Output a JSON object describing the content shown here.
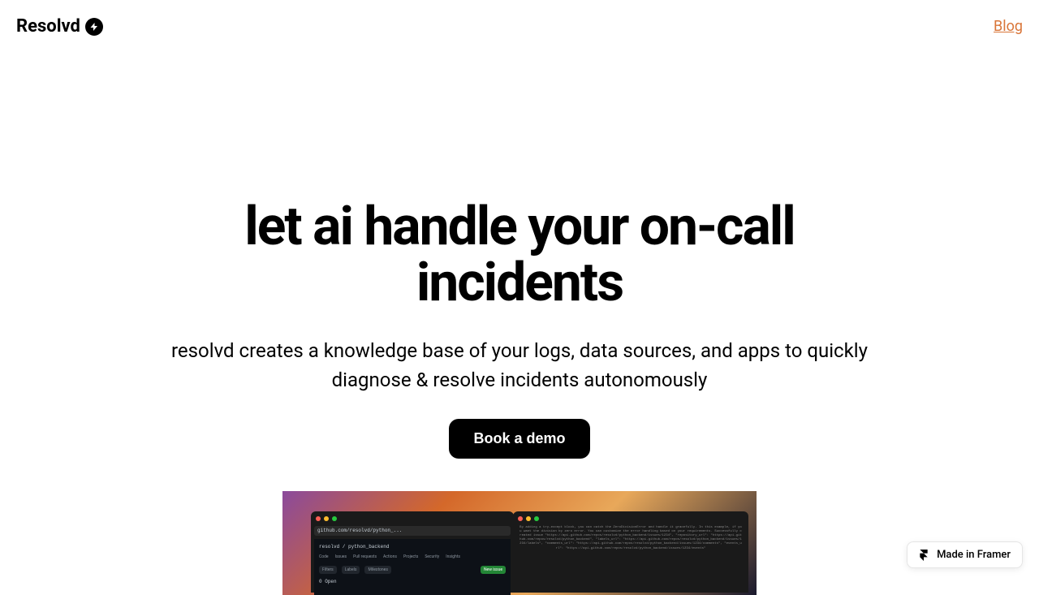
{
  "header": {
    "logo_text": "Resolvd",
    "nav_link": "Blog"
  },
  "hero": {
    "title": "let ai handle your on-call incidents",
    "subtitle": "resolvd creates a knowledge base of your logs, data sources, and apps to quickly diagnose & resolve incidents autonomously",
    "cta": "Book a demo"
  },
  "screenshot": {
    "browser_url": "github.com/resolvd/python_...",
    "repo_name": "resolvd / python_backend",
    "tabs": [
      "Code",
      "Issues",
      "Pull requests",
      "Actions",
      "Projects",
      "Security",
      "Insights"
    ],
    "filters": [
      "Filters",
      "",
      "Labels",
      "Milestones"
    ],
    "new_issue": "New issue",
    "issue_status": "0 Open"
  },
  "framer": {
    "badge_text": "Made in Framer"
  }
}
